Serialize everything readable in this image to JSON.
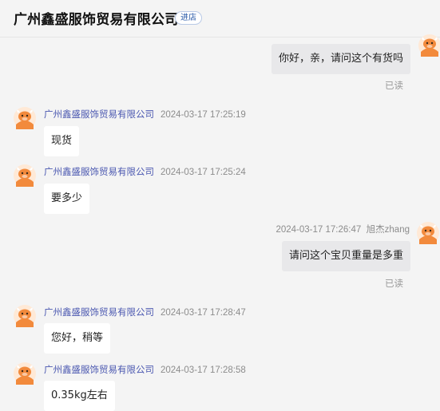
{
  "header": {
    "shop_name": "广州鑫盛服饰贸易有限公司",
    "enter_shop_label": "进店"
  },
  "messages": [
    {
      "side": "right",
      "text": "你好，亲，请问这个有货吗",
      "status": "已读"
    },
    {
      "side": "left",
      "sender": "广州鑫盛服饰贸易有限公司",
      "time": "2024-03-17 17:25:19",
      "text": "现货"
    },
    {
      "side": "left",
      "sender": "广州鑫盛服饰贸易有限公司",
      "time": "2024-03-17 17:25:24",
      "text": "要多少"
    },
    {
      "side": "right",
      "sender": "旭杰zhang",
      "time": "2024-03-17 17:26:47",
      "text": "请问这个宝贝重量是多重",
      "status": "已读"
    },
    {
      "side": "left",
      "sender": "广州鑫盛服饰贸易有限公司",
      "time": "2024-03-17 17:28:47",
      "text": "您好，稍等"
    },
    {
      "side": "left",
      "sender": "广州鑫盛服饰贸易有限公司",
      "time": "2024-03-17 17:28:58",
      "text": "0.35kg左右"
    }
  ],
  "colors": {
    "background": "#f4f4f4",
    "sender_name": "#4a57b0",
    "timestamp": "#8c8c8c",
    "avatar": "#f28a3c",
    "bubble_other": "#ffffff",
    "bubble_mine": "#e8e8ea"
  },
  "icons": {
    "avatar": "cow-mascot-icon"
  }
}
